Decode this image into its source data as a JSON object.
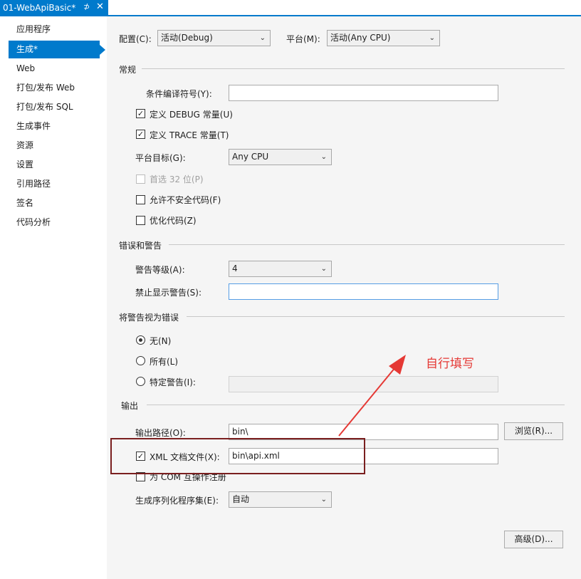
{
  "tab": {
    "title": "01-WebApiBasic*",
    "pin_glyph": "⊅",
    "close_glyph": "✕"
  },
  "sidebar": {
    "items": [
      {
        "label": "应用程序"
      },
      {
        "label": "生成*"
      },
      {
        "label": "Web"
      },
      {
        "label": "打包/发布 Web"
      },
      {
        "label": "打包/发布 SQL"
      },
      {
        "label": "生成事件"
      },
      {
        "label": "资源"
      },
      {
        "label": "设置"
      },
      {
        "label": "引用路径"
      },
      {
        "label": "签名"
      },
      {
        "label": "代码分析"
      }
    ],
    "selected_index": 1
  },
  "toolbar": {
    "config_label": "配置(C):",
    "config_value": "活动(Debug)",
    "platform_label": "平台(M):",
    "platform_value": "活动(Any CPU)"
  },
  "general": {
    "title": "常规",
    "symbols_label": "条件编译符号(Y):",
    "symbols_value": "",
    "debug_label": "定义 DEBUG 常量(U)",
    "debug_checked": true,
    "trace_label": "定义 TRACE 常量(T)",
    "trace_checked": true,
    "target_label": "平台目标(G):",
    "target_value": "Any CPU",
    "prefer32_label": "首选 32 位(P)",
    "prefer32_checked": false,
    "unsafe_label": "允许不安全代码(F)",
    "unsafe_checked": false,
    "optimize_label": "优化代码(Z)",
    "optimize_checked": false
  },
  "errors": {
    "title": "错误和警告",
    "level_label": "警告等级(A):",
    "level_value": "4",
    "suppress_label": "禁止显示警告(S):",
    "suppress_value": ""
  },
  "treat": {
    "title": "将警告视为错误",
    "none_label": "无(N)",
    "all_label": "所有(L)",
    "specific_label": "特定警告(I):",
    "specific_value": "",
    "selected": "none"
  },
  "output": {
    "title": "输出",
    "path_label": "输出路径(O):",
    "path_value": "bin\\",
    "browse_label": "浏览(R)...",
    "xml_label": "XML 文档文件(X):",
    "xml_checked": true,
    "xml_value": "bin\\api.xml",
    "com_label": "为 COM 互操作注册",
    "com_checked": false,
    "serial_label": "生成序列化程序集(E):",
    "serial_value": "自动",
    "advanced_label": "高级(D)..."
  },
  "annotation": {
    "text": "自行填写",
    "color": "#e53935",
    "box_color": "#7a1f1f"
  },
  "colors": {
    "accent": "#007acc"
  },
  "glyphs": {
    "check": "✓",
    "chevron": "⌄"
  }
}
